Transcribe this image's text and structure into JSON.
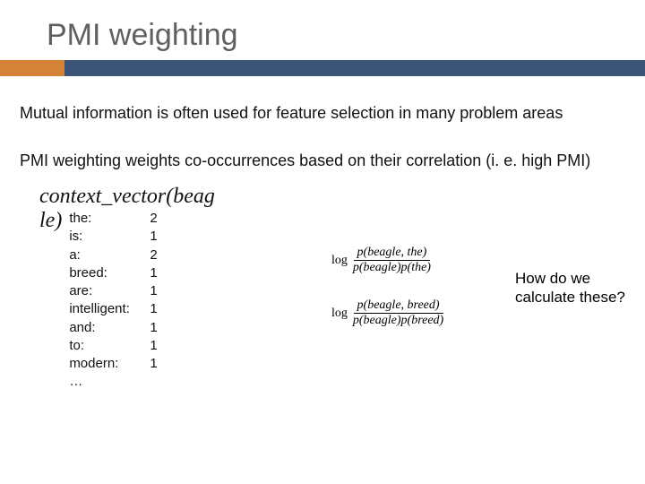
{
  "title": "PMI weighting",
  "para1": "Mutual information is often used for feature selection in many problem areas",
  "para2": "PMI weighting weights co-occurrences based on their correlation (i. e. high PMI)",
  "cv": {
    "label_line1": "context_vector(beag",
    "label_line2": "le)",
    "rows": [
      {
        "word": "the:",
        "val": "2"
      },
      {
        "word": "is:",
        "val": "1"
      },
      {
        "word": "a:",
        "val": "2"
      },
      {
        "word": "breed:",
        "val": "1"
      },
      {
        "word": "are:",
        "val": "1"
      },
      {
        "word": "intelligent:",
        "val": "1"
      },
      {
        "word": "and:",
        "val": "1"
      },
      {
        "word": "to:",
        "val": "1"
      },
      {
        "word": "modern:",
        "val": "1"
      },
      {
        "word": "…",
        "val": ""
      }
    ]
  },
  "formulas": {
    "f1": {
      "log": "log",
      "num": "p(beagle, the)",
      "den": "p(beagle)p(the)"
    },
    "f2": {
      "log": "log",
      "num": "p(beagle, breed)",
      "den": "p(beagle)p(breed)"
    }
  },
  "question": "How do we calculate these?"
}
